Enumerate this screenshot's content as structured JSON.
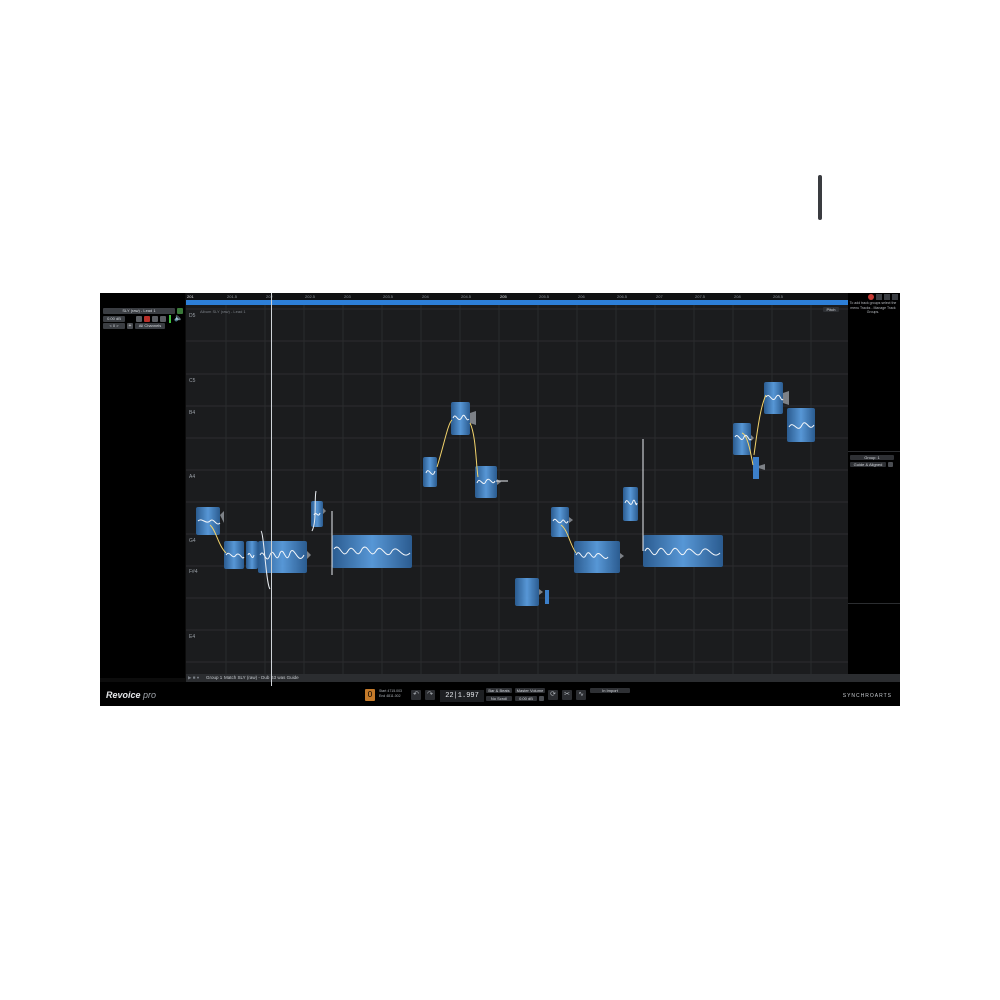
{
  "app": {
    "logo_main": "Revoice",
    "logo_sub": " pro",
    "brand": "SYNCHROARTS"
  },
  "left_panel": {
    "track_select": "SLY (raw) - Lead 1",
    "offset_value": "0.00 dB",
    "channels_prefix": "< 0 >",
    "channels_select": "All Channels"
  },
  "ruler": {
    "ticks": [
      "201",
      "201.5",
      "202",
      "202.5",
      "203",
      "203.5",
      "204",
      "204.5",
      "205",
      "205.5",
      "206",
      "206.5",
      "207",
      "207.5",
      "208",
      "208.5"
    ]
  },
  "editor": {
    "track_label": "Album SLY (raw) - Lead 1",
    "note_labels": [
      "D5",
      "C5",
      "B4",
      "A4",
      "G4",
      "F#4",
      "E4"
    ],
    "pitch_tag": "Pitch"
  },
  "right_panel": {
    "hint": "To add track groups select the menu Tracks - Manage Track Groups.",
    "group_label": "Group: 1",
    "group_mode": "Guide & Aligned"
  },
  "group_strip": {
    "group": "Group 1",
    "match_text": "Match SLY (raw) - Dub B3 was Guide"
  },
  "transport": {
    "start_label": "Start",
    "start_value": "4715.003",
    "end_label": "End",
    "end_value": "4811.002",
    "timecode": "22|1.997",
    "bar_beats": "Bar & Beats",
    "no_scroll": "No Scroll",
    "master_volume": "Master Volume",
    "volume_value": "0.00 dB",
    "preset": "In Import"
  },
  "colors": {
    "accent": "#2d7fd8",
    "blob": "#4a8fd6",
    "pitch": "#ffffff",
    "transition": "#f2d36b"
  }
}
